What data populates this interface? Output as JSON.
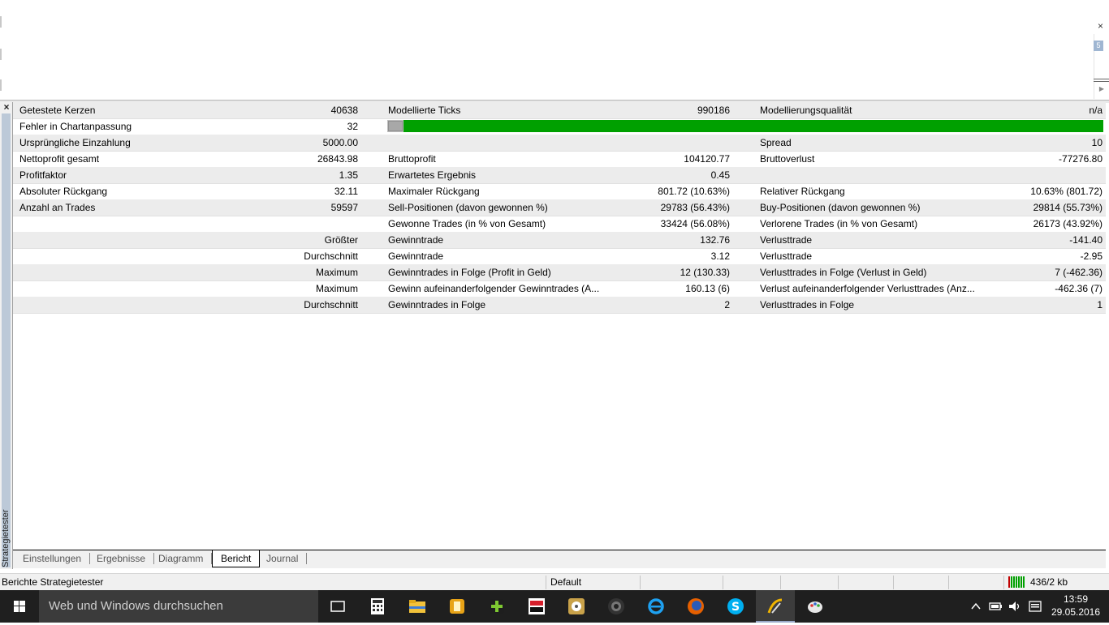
{
  "side_panel": {
    "close_label": "×",
    "title": "Strategietester"
  },
  "report": {
    "rows": [
      {
        "c1": "Getestete Kerzen",
        "c2": "40638",
        "c3": "Modellierte Ticks",
        "c4": "990186",
        "c5": "Modellierungsqualität",
        "c6": "n/a"
      },
      {
        "c1": "Fehler in Chartanpassung",
        "c2": "32",
        "c3": "",
        "c4": "",
        "c5": "",
        "c6": ""
      },
      {
        "c1": "Ursprüngliche Einzahlung",
        "c2": "5000.00",
        "c3": "",
        "c4": "",
        "c5": "Spread",
        "c6": "10"
      },
      {
        "c1": "Nettoprofit gesamt",
        "c2": "26843.98",
        "c3": "Bruttoprofit",
        "c4": "104120.77",
        "c5": "Bruttoverlust",
        "c6": "-77276.80"
      },
      {
        "c1": "Profitfaktor",
        "c2": "1.35",
        "c3": "Erwartetes Ergebnis",
        "c4": "0.45",
        "c5": "",
        "c6": ""
      },
      {
        "c1": "Absoluter Rückgang",
        "c2": "32.11",
        "c3": "Maximaler Rückgang",
        "c4": "801.72 (10.63%)",
        "c5": "Relativer Rückgang",
        "c6": "10.63% (801.72)"
      },
      {
        "c1": "Anzahl an Trades",
        "c2": "59597",
        "c3": "Sell-Positionen (davon gewonnen %)",
        "c4": "29783 (56.43%)",
        "c5": "Buy-Positionen (davon gewonnen %)",
        "c6": "29814 (55.73%)"
      },
      {
        "c1": "",
        "c2": "",
        "c3": "Gewonne Trades (in % von Gesamt)",
        "c4": "33424 (56.08%)",
        "c5": "Verlorene Trades (in % von Gesamt)",
        "c6": "26173 (43.92%)"
      },
      {
        "c1": "",
        "c2": "Größter",
        "c3": "Gewinntrade",
        "c4": "132.76",
        "c5": "Verlusttrade",
        "c6": "-141.40"
      },
      {
        "c1": "",
        "c2": "Durchschnitt",
        "c3": "Gewinntrade",
        "c4": "3.12",
        "c5": "Verlusttrade",
        "c6": "-2.95"
      },
      {
        "c1": "",
        "c2": "Maximum",
        "c3": "Gewinntrades in Folge (Profit in Geld)",
        "c4": "12 (130.33)",
        "c5": "Verlusttrades in Folge (Verlust in Geld)",
        "c6": "7 (-462.36)"
      },
      {
        "c1": "",
        "c2": "Maximum",
        "c3": "Gewinn aufeinanderfolgender Gewinntrades (A...",
        "c4": "160.13 (6)",
        "c5": "Verlust aufeinanderfolgender Verlusttrades (Anz...",
        "c6": "-462.36 (7)"
      },
      {
        "c1": "",
        "c2": "Durchschnitt",
        "c3": "Gewinntrades in Folge",
        "c4": "2",
        "c5": "Verlusttrades in Folge",
        "c6": "1"
      }
    ],
    "quality_bar": {
      "filled_fraction": 0.98,
      "fill_color": "#00a000"
    }
  },
  "tabs": [
    "Einstellungen",
    "Ergebnisse",
    "Diagramm",
    "Bericht",
    "Journal"
  ],
  "active_tab": "Bericht",
  "statusbar": {
    "left_text": "Berichte Strategietester",
    "profile": "Default",
    "traffic": "436/2 kb"
  },
  "taskbar": {
    "search_placeholder": "Web und Windows durchsuchen",
    "apps": [
      "task-view-icon",
      "calculator-icon",
      "file-explorer-icon",
      "notes-icon",
      "plus-app-icon",
      "lovefilm-icon",
      "disc-app-icon",
      "speaker-app-icon",
      "internet-explorer-icon",
      "firefox-icon",
      "skype-icon",
      "metatrader-icon",
      "paint-icon"
    ],
    "time": "13:59",
    "date": "29.05.2016"
  },
  "colors": {
    "accent_green": "#00a000",
    "taskbar_bg": "#1f1f1f",
    "row_shade": "#ececec"
  }
}
